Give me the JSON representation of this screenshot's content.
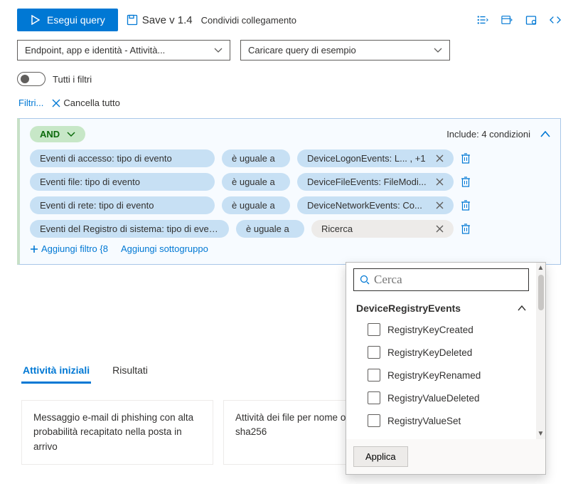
{
  "toolbar": {
    "run_label": "Esegui query",
    "save_label": "Save v 1.4",
    "share_label": "Condividi collegamento"
  },
  "dropdowns": {
    "schema": "Endpoint, app e identità - Attività...",
    "sample": "Caricare query di esempio"
  },
  "toggle": {
    "label": "Tutti i filtri"
  },
  "filter_actions": {
    "filter_label": "Filtri...",
    "clear_label": "Cancella tutto"
  },
  "query": {
    "operator": "AND",
    "include_text": "Include: 4 condizioni",
    "conditions": [
      {
        "field": "Eventi di accesso: tipo di evento",
        "op": "è uguale a",
        "value": "DeviceLogonEvents: L... , +1",
        "value_style": "blue"
      },
      {
        "field": "Eventi file: tipo di evento",
        "op": "è uguale a",
        "value": "DeviceFileEvents: FileModi...",
        "value_style": "blue"
      },
      {
        "field": "Eventi di rete: tipo di evento",
        "op": "è uguale a",
        "value": "DeviceNetworkEvents: Co...",
        "value_style": "blue"
      },
      {
        "field": "Eventi del Registro di sistema: tipo di evento",
        "op": "è uguale a",
        "value": "Ricerca",
        "value_style": "gray"
      }
    ],
    "add_filter": "Aggiungi filtro {8",
    "add_subgroup": "Aggiungi sottogruppo"
  },
  "dropdown_panel": {
    "search_placeholder": "Cerca",
    "group": "DeviceRegistryEvents",
    "options": [
      "RegistryKeyCreated",
      "RegistryKeyDeleted",
      "RegistryKeyRenamed",
      "RegistryValueDeleted",
      "RegistryValueSet"
    ],
    "apply": "Applica"
  },
  "tabs": {
    "t1": "Attività iniziali",
    "t2": "Risultati"
  },
  "cards": {
    "c1": "Messaggio e-mail di phishing con alta probabilità recapitato nella posta in arrivo",
    "c2": "Attività dei file per nome o sha256"
  }
}
